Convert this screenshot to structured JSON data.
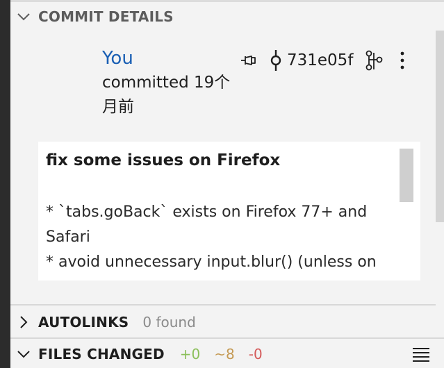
{
  "commit_details": {
    "title": "COMMIT DETAILS",
    "author": "You",
    "committed": "committed 19个月前",
    "sha": "731e05f",
    "message": {
      "title": "fix some issues on Firefox",
      "lines": [
        "* `tabs.goBack` exists on Firefox 77+ and",
        "Safari",
        "* avoid unnecessary input.blur() (unless on"
      ]
    },
    "icons": [
      "pin-icon",
      "commit-icon",
      "graph-icon",
      "more-icon"
    ]
  },
  "autolinks": {
    "title": "AUTOLINKS",
    "count": "0 found"
  },
  "files_changed": {
    "title": "FILES CHANGED",
    "added": "+0",
    "modified": "~8",
    "removed": "-0"
  },
  "colors": {
    "author_link": "#1a5fb4",
    "added": "#8bbf5a",
    "modified": "#c59a54",
    "removed": "#d45a5a",
    "background": "#f3f3f3",
    "message_bg": "#ffffff"
  }
}
